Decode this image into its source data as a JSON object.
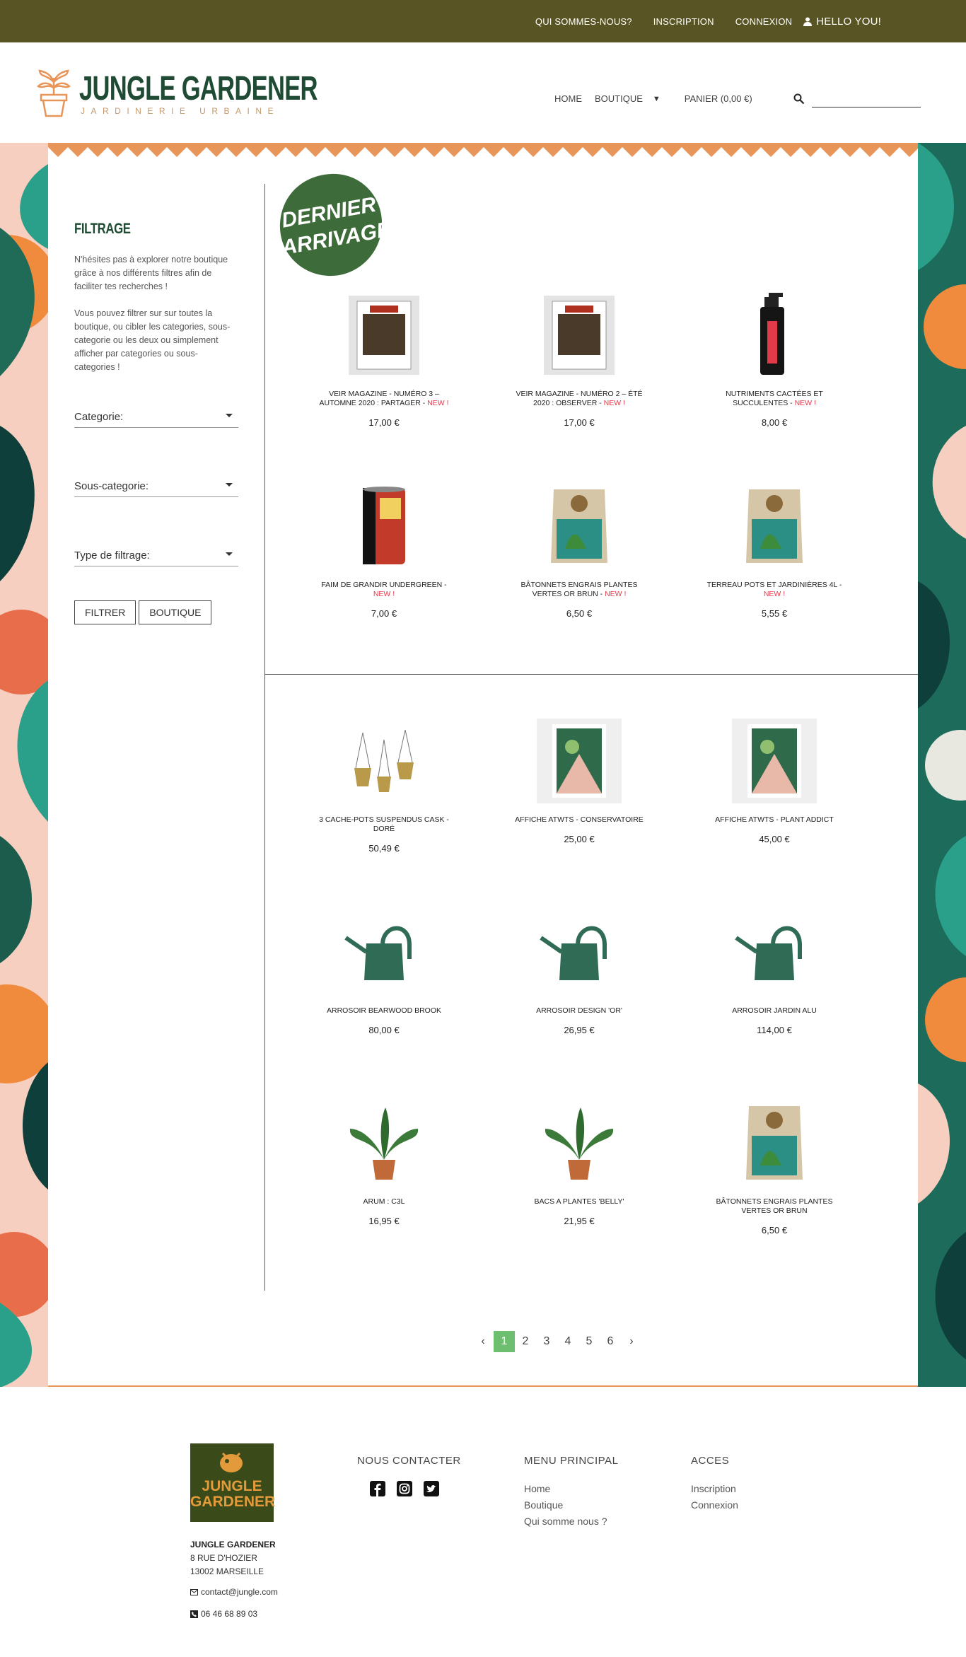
{
  "topbar": {
    "links": [
      "QUI SOMMES-NOUS?",
      "INSCRIPTION",
      "CONNEXION"
    ],
    "user": "HELLO YOU!"
  },
  "brand": {
    "name": "JUNGLE GARDENER",
    "tagline": "JARDINERIE URBAINE",
    "colors": {
      "primary": "#1f4a33",
      "topbar": "#595424",
      "accent": "#e8955a",
      "new": "#e33a4a",
      "pager": "#6dbf6f"
    }
  },
  "nav": {
    "home": "HOME",
    "shop": "BOUTIQUE",
    "cart": "PANIER (0,00 €)",
    "search_icon": "search-icon"
  },
  "sidebar": {
    "title": "FILTRAGE",
    "intro": "N'hésites pas à explorer notre boutique grâce à nos différents filtres afin de faciliter tes recherches !",
    "intro2": "Vous pouvez filtrer sur sur toutes la boutique, ou cibler les categories, sous-categorie ou les deux ou simplement afficher par categories ou sous-categories !",
    "select1": "Categorie:",
    "select2": "Sous-categorie:",
    "select3": "Type de filtrage:",
    "btn_filter": "FILTRER",
    "btn_shop": "BOUTIQUE"
  },
  "badge": {
    "line1": "DERNIER",
    "line2": "ARRIVAGE"
  },
  "new_label": "NEW !",
  "latest": [
    {
      "name": "VEIR MAGAZINE - NUMÉRO 3 – AUTOMNE 2020 : PARTAGER -",
      "new": true,
      "price": "17,00 €",
      "icon": "magazine-icon"
    },
    {
      "name": "VEIR MAGAZINE - NUMÉRO 2 – ÉTÉ 2020 : OBSERVER -",
      "new": true,
      "price": "17,00 €",
      "icon": "magazine-icon"
    },
    {
      "name": "NUTRIMENTS CACTÉES ET SUCCULENTES -",
      "new": true,
      "price": "8,00 €",
      "icon": "bottle-icon"
    },
    {
      "name": "FAIM DE GRANDIR UNDERGREEN -",
      "new": true,
      "price": "7,00 €",
      "icon": "can-icon"
    },
    {
      "name": "BÂTONNETS ENGRAIS PLANTES VERTES OR BRUN -",
      "new": true,
      "price": "6,50 €",
      "icon": "bag-icon"
    },
    {
      "name": "TERREAU POTS ET JARDINIÈRES 4L -",
      "new": true,
      "price": "5,55 €",
      "icon": "bag-icon"
    }
  ],
  "products": [
    {
      "name": "3 CACHE-POTS SUSPENDUS CASK - DORÉ",
      "price": "50,49 €",
      "icon": "hanging-pots-icon"
    },
    {
      "name": "AFFICHE ATWTS - CONSERVATOIRE",
      "price": "25,00 €",
      "icon": "poster-icon"
    },
    {
      "name": "AFFICHE ATWTS - PLANT ADDICT",
      "price": "45,00 €",
      "icon": "poster-icon"
    },
    {
      "name": "ARROSOIR BEARWOOD BROOK",
      "price": "80,00 €",
      "icon": "watering-can-icon"
    },
    {
      "name": "ARROSOIR DESIGN 'OR'",
      "price": "26,95 €",
      "icon": "watering-can-icon"
    },
    {
      "name": "ARROSOIR JARDIN ALU",
      "price": "114,00 €",
      "icon": "watering-can-icon"
    },
    {
      "name": "ARUM : C3L",
      "price": "16,95 €",
      "icon": "plant-icon"
    },
    {
      "name": "BACS A PLANTES 'BELLY'",
      "price": "21,95 €",
      "icon": "plant-icon"
    },
    {
      "name": "BÂTONNETS ENGRAIS PLANTES VERTES OR BRUN",
      "price": "6,50 €",
      "icon": "bag-icon"
    }
  ],
  "pager": {
    "prev": "‹",
    "pages": [
      "1",
      "2",
      "3",
      "4",
      "5",
      "6"
    ],
    "next": "›",
    "current": "1"
  },
  "footer": {
    "logo1": "JUNGLE",
    "logo2": "GARDENER",
    "company": "JUNGLE GARDENER",
    "address1": "8 RUE D'HOZIER",
    "address2": "13002 MARSEILLE",
    "email": "contact@jungle.com",
    "phone": "06 46 68 89 03",
    "contact_title": "NOUS CONTACTER",
    "menu_title": "MENU PRINCIPAL",
    "menu": [
      "Home",
      "Boutique",
      "Qui somme nous ?"
    ],
    "access_title": "ACCES",
    "access": [
      "Inscription",
      "Connexion"
    ]
  }
}
